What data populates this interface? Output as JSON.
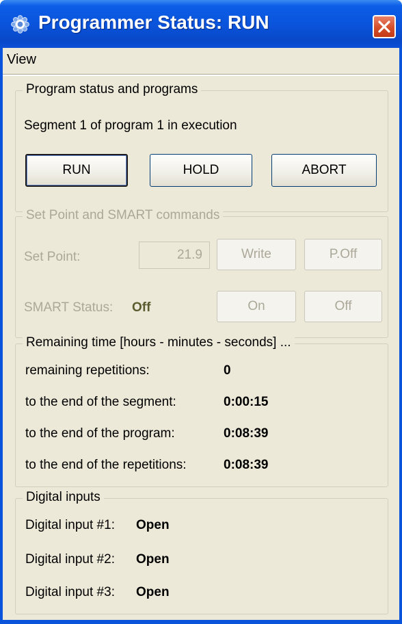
{
  "window": {
    "title": "Programmer Status: RUN"
  },
  "menu": {
    "items": [
      "View"
    ]
  },
  "program_status": {
    "title": "Program status and programs",
    "message": "Segment 1 of program 1 in execution",
    "buttons": {
      "run": "RUN",
      "hold": "HOLD",
      "abort": "ABORT"
    }
  },
  "setpoint": {
    "title": "Set Point and SMART commands",
    "setpoint_label": "Set Point:",
    "setpoint_value": "21.9",
    "write_label": "Write",
    "poff_label": "P.Off",
    "smart_label": "SMART Status:",
    "smart_value": "Off",
    "on_label": "On",
    "off_label": "Off"
  },
  "remaining": {
    "title": "Remaining time [hours - minutes - seconds] ...",
    "rows": [
      {
        "label": "remaining repetitions:",
        "value": "0"
      },
      {
        "label": "to the end of the segment:",
        "value": "0:00:15"
      },
      {
        "label": "to the end of the program:",
        "value": "0:08:39"
      },
      {
        "label": "to the end of the repetitions:",
        "value": "0:08:39"
      }
    ]
  },
  "digital": {
    "title": "Digital inputs",
    "rows": [
      {
        "label": "Digital input #1:",
        "value": "Open"
      },
      {
        "label": "Digital input #2:",
        "value": "Open"
      },
      {
        "label": "Digital input #3:",
        "value": "Open"
      }
    ]
  },
  "icons": {
    "app": "gear-icon",
    "close": "close-icon"
  },
  "colors": {
    "titlebar": "#0a54dc",
    "close": "#d54e2a",
    "face": "#ece9d8",
    "disabled_text": "#aca899"
  }
}
